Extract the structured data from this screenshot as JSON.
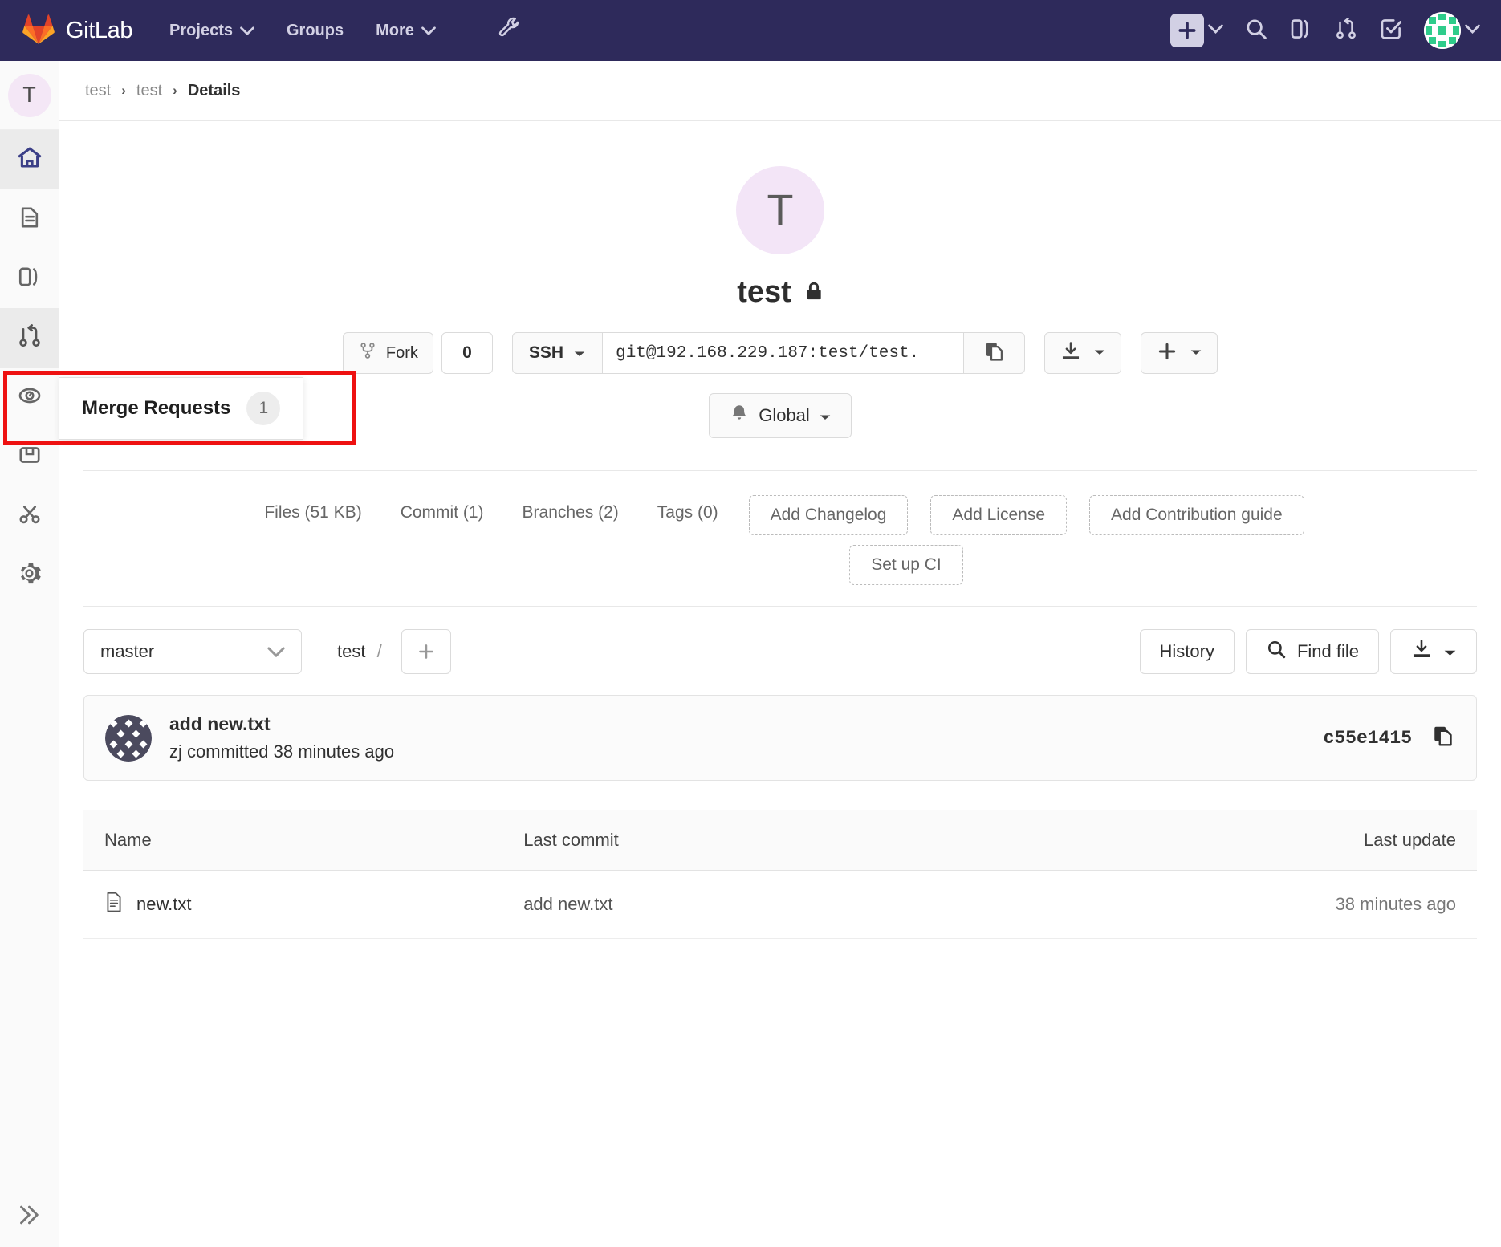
{
  "navbar": {
    "brand": "GitLab",
    "logo_icon": "gitlab-logo-icon",
    "links": [
      {
        "label": "Projects",
        "icon": "chevron-down-icon",
        "has_caret": true
      },
      {
        "label": "Groups",
        "icon": "",
        "has_caret": false
      },
      {
        "label": "More",
        "icon": "chevron-down-icon",
        "has_caret": true
      }
    ],
    "wrench_icon": "wrench-icon",
    "right_icons": [
      {
        "name": "plus-icon",
        "caret": true
      },
      {
        "name": "search-icon",
        "caret": false
      },
      {
        "name": "issues-board-icon",
        "caret": false
      },
      {
        "name": "merge-request-icon",
        "caret": false
      },
      {
        "name": "todos-checkmark-icon",
        "caret": false
      }
    ],
    "avatar_alt": "user-avatar",
    "bg_color": "#2e2a5b"
  },
  "sidebar": {
    "project_initial": "T",
    "items": [
      {
        "name": "home",
        "icon": "home-icon",
        "active": true
      },
      {
        "name": "repository",
        "icon": "file-document-icon",
        "active": false
      },
      {
        "name": "issues",
        "icon": "issues-icon",
        "active": false
      },
      {
        "name": "merge-requests",
        "icon": "merge-request-icon",
        "active": true
      },
      {
        "name": "ci-cd",
        "icon": "rocket-gauge-icon",
        "active": false
      },
      {
        "name": "packages",
        "icon": "package-icon",
        "active": false
      },
      {
        "name": "snippets",
        "icon": "scissors-icon",
        "active": false
      },
      {
        "name": "settings",
        "icon": "gear-icon",
        "active": false
      }
    ],
    "collapse_icon": "chevron-double-right-icon"
  },
  "mr_flyout": {
    "label": "Merge Requests",
    "count": "1",
    "highlight_color": "#ee1111"
  },
  "breadcrumb": {
    "items": [
      "test",
      "test"
    ],
    "current": "Details",
    "separator": "›"
  },
  "project": {
    "avatar_initial": "T",
    "avatar_bg": "#f3e5f7",
    "title": "test",
    "visibility_icon": "lock-icon"
  },
  "actions": {
    "fork_label": "Fork",
    "fork_icon": "fork-icon",
    "fork_count": "0",
    "clone_protocol": "SSH",
    "clone_url": "git@192.168.229.187:test/test.",
    "copy_icon": "copy-icon",
    "download_icon": "download-icon",
    "plus_icon": "plus-icon",
    "caret_icon": "chevron-down-icon",
    "notification_label": "Global",
    "notification_icon": "bell-icon"
  },
  "stats": {
    "links": [
      "Files (51 KB)",
      "Commit (1)",
      "Branches (2)",
      "Tags (0)"
    ],
    "dashed_row1": [
      "Add Changelog",
      "Add License",
      "Add Contribution guide"
    ],
    "dashed_row2": [
      "Set up CI"
    ]
  },
  "tree_controls": {
    "branch": "master",
    "branch_caret": "chevron-down-icon",
    "path_root": "test",
    "path_separator": "/",
    "add_button_icon": "plus-icon",
    "history_label": "History",
    "find_file_label": "Find file",
    "find_file_icon": "search-icon",
    "download_icon": "download-icon"
  },
  "last_commit": {
    "avatar_alt": "identicon-avatar",
    "title": "add new.txt",
    "author": "zj",
    "meta_verb": "committed",
    "time_ago": "38 minutes ago",
    "sha": "c55e1415",
    "copy_icon": "copy-icon"
  },
  "file_table": {
    "columns": [
      "Name",
      "Last commit",
      "Last update"
    ],
    "rows": [
      {
        "icon": "file-text-icon",
        "name": "new.txt",
        "last_commit": "add new.txt",
        "last_update": "38 minutes ago"
      }
    ]
  }
}
